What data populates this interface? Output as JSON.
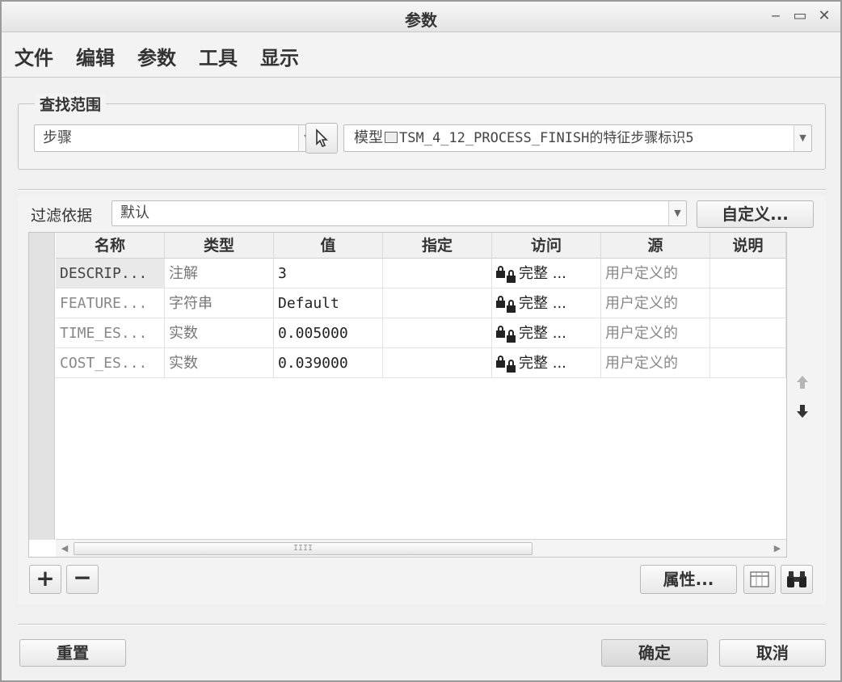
{
  "window": {
    "title": "参数",
    "minimize": "‒",
    "maximize": "▭",
    "close": "✕"
  },
  "menu": [
    "文件",
    "编辑",
    "参数",
    "工具",
    "显示"
  ],
  "scope": {
    "legend": "查找范围",
    "type_value": "步骤",
    "model_prefix": "模型",
    "model_value": "TSM_4_12_PROCESS_FINISH的特征步骤标识5"
  },
  "filter": {
    "label": "过滤依据",
    "value": "默认",
    "customize_button": "自定义..."
  },
  "table": {
    "columns": [
      "名称",
      "类型",
      "值",
      "指定",
      "访问",
      "源",
      "说明"
    ],
    "rows": [
      {
        "name": "DESCRIP...",
        "type": "注解",
        "value": "3",
        "designate": "",
        "access": "完整 ...",
        "source": "用户定义的",
        "desc": ""
      },
      {
        "name": "FEATURE...",
        "type": "字符串",
        "value": "Default",
        "designate": "",
        "access": "完整 ...",
        "source": "用户定义的",
        "desc": ""
      },
      {
        "name": "TIME_ES...",
        "type": "实数",
        "value": "0.005000",
        "designate": "",
        "access": "完整 ...",
        "source": "用户定义的",
        "desc": ""
      },
      {
        "name": "COST_ES...",
        "type": "实数",
        "value": "0.039000",
        "designate": "",
        "access": "完整 ...",
        "source": "用户定义的",
        "desc": ""
      }
    ],
    "scroll_grip": "IIII"
  },
  "buttons": {
    "add": "+",
    "remove": "−",
    "properties": "属性...",
    "reset": "重置",
    "ok": "确定",
    "cancel": "取消"
  },
  "icons": {
    "move_up": "arrow-up-icon",
    "move_down": "arrow-down-icon",
    "columns": "table-columns-icon",
    "find": "binoculars-icon",
    "pointer": "select-pointer-icon",
    "lock": "lock-icon"
  }
}
